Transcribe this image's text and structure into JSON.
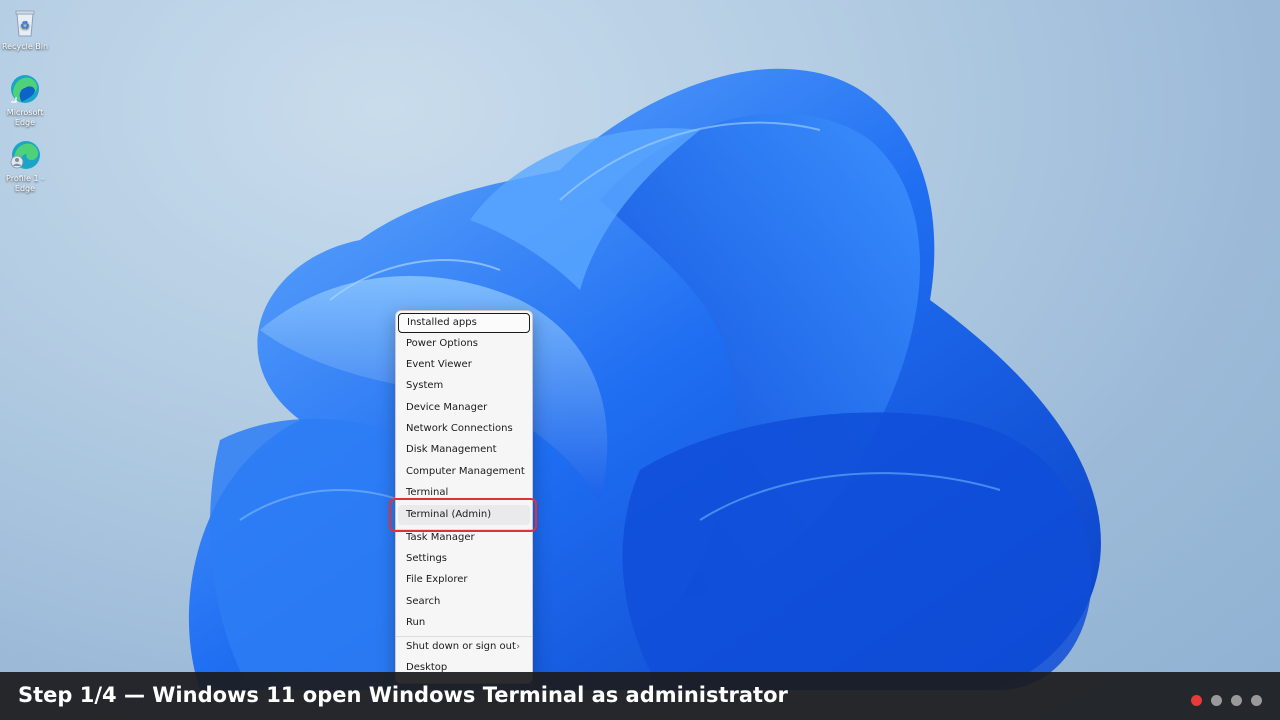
{
  "desktop_icons": [
    {
      "name": "recycle-bin",
      "label": "Recycle Bin"
    },
    {
      "name": "microsoft-edge",
      "label": "Microsoft Edge"
    },
    {
      "name": "profile-edge",
      "label": "Profile 1 - Edge"
    }
  ],
  "menu": {
    "items": [
      {
        "label": "Installed apps",
        "state": "focused"
      },
      {
        "label": "Power Options"
      },
      {
        "label": "Event Viewer"
      },
      {
        "label": "System"
      },
      {
        "label": "Device Manager"
      },
      {
        "label": "Network Connections"
      },
      {
        "label": "Disk Management"
      },
      {
        "label": "Computer Management"
      },
      {
        "label": "Terminal"
      },
      {
        "label": "Terminal (Admin)",
        "state": "highlighted"
      },
      {
        "label": "Task Manager"
      },
      {
        "label": "Settings"
      },
      {
        "label": "File Explorer"
      },
      {
        "label": "Search"
      },
      {
        "label": "Run"
      },
      {
        "label": "Shut down or sign out",
        "submenu": true
      },
      {
        "label": "Desktop"
      }
    ]
  },
  "banner": {
    "title": "Step 1/4 — Windows 11 open Windows Terminal as administrator",
    "steps_total": 4,
    "step_current": 1
  },
  "colors": {
    "accent_red": "#e0303a",
    "active_dot": "#e83a3a",
    "inactive_dot": "#9a9a9a"
  }
}
